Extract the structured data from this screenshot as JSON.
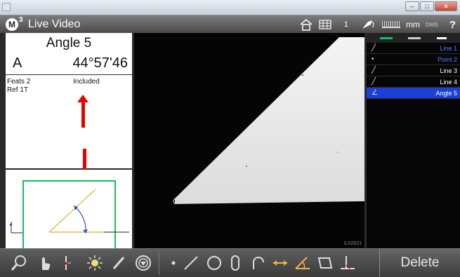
{
  "window": {
    "minimize": "–",
    "maximize": "□",
    "close": "✕"
  },
  "header": {
    "logo_letter": "M",
    "logo_sup": "3",
    "title": "Live Video",
    "channel": "1",
    "unit": "mm",
    "angle_format": "DMS",
    "help": "?"
  },
  "dro": {
    "title": "Angle 5",
    "axis_letter": "A",
    "value": "44°57'46",
    "feats_label": "Feats 2",
    "ref_label": "Ref 1T",
    "type_label": "Included"
  },
  "video": {
    "scale_label": "0.02521"
  },
  "features": {
    "items": [
      {
        "name": "Line 1",
        "icon": "line-icon",
        "color": "#5a7cff"
      },
      {
        "name": "Point 2",
        "icon": "point-icon",
        "color": "#5a7cff"
      },
      {
        "name": "Line 3",
        "icon": "line-icon",
        "color": "#ffffff"
      },
      {
        "name": "Line 4",
        "icon": "line-icon",
        "color": "#ffffff"
      },
      {
        "name": "Angle 5",
        "icon": "angle-icon",
        "color": "#ffffff",
        "selected": true
      }
    ]
  },
  "toolbar": {
    "delete_label": "Delete"
  },
  "colors": {
    "accent": "#1d3fd6",
    "green": "#10c060",
    "annotation": "#e80000"
  }
}
